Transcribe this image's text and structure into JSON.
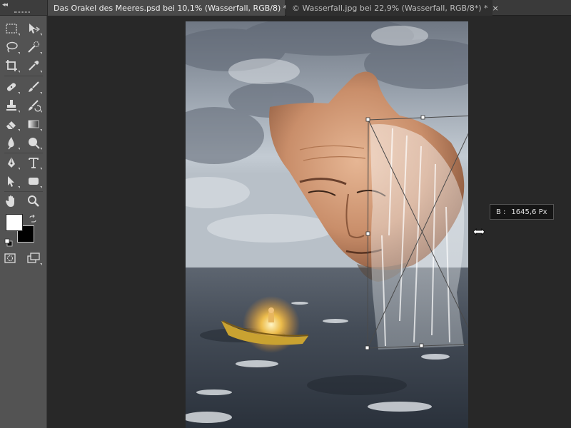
{
  "tabs": [
    {
      "label": "Das Orakel des Meeres.psd bei 10,1% (Wasserfall, RGB/8) *",
      "close": "×",
      "active": true
    },
    {
      "label": "© Wasserfall.jpg bei 22,9% (Wasserfall, RGB/8*) *",
      "close": "×",
      "active": false
    }
  ],
  "tooltip": {
    "label": "B :",
    "value": "1645,6 Px"
  },
  "colors": {
    "foreground": "#ffffff",
    "background": "#000000",
    "ui_panel": "#535353",
    "workspace": "#282828"
  },
  "tools": [
    "marquee-icon",
    "move-icon",
    "lasso-icon",
    "quick-select-icon",
    "crop-icon",
    "eyedropper-icon",
    "healing-brush-icon",
    "brush-icon",
    "clone-stamp-icon",
    "history-brush-icon",
    "eraser-icon",
    "gradient-icon",
    "blur-icon",
    "dodge-icon",
    "pen-icon",
    "type-icon",
    "path-select-icon",
    "shape-icon",
    "hand-icon",
    "zoom-icon"
  ],
  "toolbar": {
    "collapse": "◂◂"
  }
}
